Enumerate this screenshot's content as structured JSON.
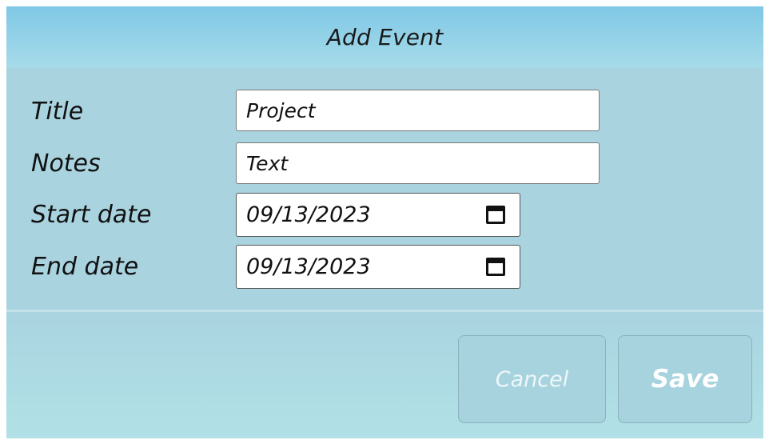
{
  "dialog": {
    "title": "Add Event"
  },
  "form": {
    "title_label": "Title",
    "title_value": "Project",
    "notes_label": "Notes",
    "notes_value": "Text",
    "start_date_label": "Start date",
    "start_date_value": "09/13/2023",
    "end_date_label": "End date",
    "end_date_value": "09/13/2023"
  },
  "buttons": {
    "cancel_label": "Cancel",
    "save_label": "Save"
  },
  "icons": {
    "start_date_picker": "calendar-icon",
    "end_date_picker": "calendar-icon"
  },
  "colors": {
    "header_gradient_top": "#7fc8e6",
    "body_background": "#a9d3df",
    "button_background": "#a6d3de"
  }
}
